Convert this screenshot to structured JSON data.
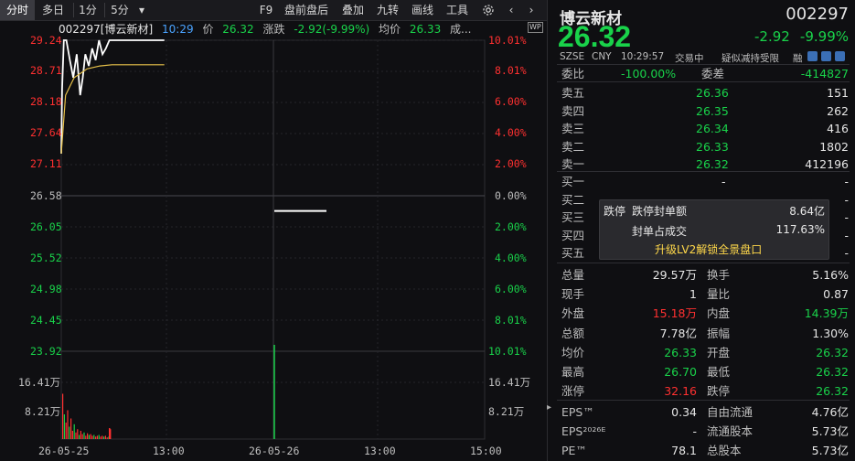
{
  "toolbar": {
    "tabs": [
      "分时",
      "多日",
      "1分",
      "5分"
    ],
    "active_tab": "分时",
    "dropdown_icon": "caret-down-icon",
    "right_items": [
      "F9",
      "盘前盘后",
      "叠加",
      "九转",
      "画线",
      "工具"
    ],
    "icons": [
      "settings-icon",
      "chevron-left-icon",
      "chevron-right-icon"
    ]
  },
  "infobar": {
    "code_name": "002297[博云新材]",
    "time": "10:29",
    "price_label": "价",
    "price": "26.32",
    "change_label": "涨跌",
    "change": "-2.92(-9.99%)",
    "avg_label": "均价",
    "avg": "26.33",
    "vol_label": "成..."
  },
  "axes": {
    "price_ticks": [
      "29.24",
      "28.71",
      "28.18",
      "27.64",
      "27.11",
      "26.58",
      "26.05",
      "25.52",
      "24.98",
      "24.45",
      "23.92"
    ],
    "pct_ticks": [
      "10.01%",
      "8.01%",
      "6.00%",
      "4.00%",
      "2.00%",
      "0.00%",
      "2.00%",
      "4.00%",
      "6.00%",
      "8.01%",
      "10.01%"
    ],
    "vol_ticks": [
      "16.41万",
      "8.21万"
    ],
    "vol_ticks_right": [
      "16.41万",
      "8.21万"
    ],
    "time_labels": [
      "26-05-25",
      "13:00",
      "26-05-26",
      "13:00",
      "15:00"
    ],
    "wp_badge": "WP"
  },
  "chart_data": {
    "type": "line",
    "title": "002297[博云新材]",
    "xlabel": "",
    "ylabel": "",
    "ylim": [
      23.92,
      29.24
    ],
    "prev_close": 26.58,
    "series": [
      {
        "name": "价",
        "x": [
          "09:30",
          "09:31",
          "09:33",
          "09:36",
          "09:40",
          "09:44",
          "09:48",
          "09:52",
          "09:55",
          "09:58",
          "10:02",
          "10:06",
          "10:10",
          "10:14",
          "10:18",
          "10:22",
          "10:26",
          "10:29",
          "11:30"
        ],
        "values": [
          27.3,
          28.4,
          29.24,
          29.24,
          28.9,
          28.6,
          29.0,
          28.3,
          28.6,
          29.0,
          28.8,
          29.1,
          28.9,
          29.24,
          29.0,
          29.1,
          29.24,
          29.24,
          29.24
        ]
      },
      {
        "name": "均价",
        "x": [
          "09:30",
          "09:35",
          "09:45",
          "10:00",
          "10:15",
          "10:29",
          "11:30"
        ],
        "values": [
          27.3,
          28.3,
          28.6,
          28.75,
          28.8,
          28.82,
          28.82
        ]
      }
    ],
    "day2": {
      "price": 26.32,
      "values": [
        26.32,
        26.32
      ]
    }
  },
  "quote": {
    "name": "博云新材",
    "code": "002297",
    "price": "26.32",
    "change": "-2.92",
    "change_pct": "-9.99%",
    "exchange": "SZSE",
    "currency": "CNY",
    "timestamp": "10:29:57",
    "status": "交易中",
    "notice": "疑似减持受限",
    "flag": "融"
  },
  "orderbook": {
    "weibi_label": "委比",
    "weibi": "-100.00%",
    "weicha_label": "委差",
    "weicha": "-414827",
    "asks": [
      {
        "label": "卖五",
        "price": "26.36",
        "vol": "151"
      },
      {
        "label": "卖四",
        "price": "26.35",
        "vol": "262"
      },
      {
        "label": "卖三",
        "price": "26.34",
        "vol": "416"
      },
      {
        "label": "卖二",
        "price": "26.33",
        "vol": "1802"
      },
      {
        "label": "卖一",
        "price": "26.32",
        "vol": "412196"
      }
    ],
    "bids": [
      {
        "label": "买一",
        "price": "-",
        "vol": "-"
      },
      {
        "label": "买二",
        "price": "-",
        "vol": "-"
      },
      {
        "label": "买三",
        "price": "-",
        "vol": "-"
      },
      {
        "label": "买四",
        "price": "-",
        "vol": "-"
      },
      {
        "label": "买五",
        "price": "-",
        "vol": "-"
      }
    ]
  },
  "popup": {
    "tag": "跌停",
    "seal_label": "跌停封单额",
    "seal_value": "8.64亿",
    "ratio_label": "封单占成交",
    "ratio_value": "117.63%",
    "upgrade": "升级LV2解锁全景盘口"
  },
  "stats": [
    {
      "l1": "总量",
      "v1": "29.57万",
      "l2": "换手",
      "v2": "5.16%",
      "c1": "white",
      "c2": "white"
    },
    {
      "l1": "现手",
      "v1": "1",
      "l2": "量比",
      "v2": "0.87",
      "c1": "white",
      "c2": "white"
    },
    {
      "l1": "外盘",
      "v1": "15.18万",
      "l2": "内盘",
      "v2": "14.39万",
      "c1": "red",
      "c2": "green"
    },
    {
      "l1": "总额",
      "v1": "7.78亿",
      "l2": "振幅",
      "v2": "1.30%",
      "c1": "white",
      "c2": "white"
    },
    {
      "l1": "均价",
      "v1": "26.33",
      "l2": "开盘",
      "v2": "26.32",
      "c1": "green",
      "c2": "green"
    },
    {
      "l1": "最高",
      "v1": "26.70",
      "l2": "最低",
      "v2": "26.32",
      "c1": "green",
      "c2": "green"
    },
    {
      "l1": "涨停",
      "v1": "32.16",
      "l2": "跌停",
      "v2": "26.32",
      "c1": "red",
      "c2": "green"
    }
  ],
  "fundamentals": [
    {
      "l1": "EPS™",
      "v1": "0.34",
      "l2": "自由流通",
      "v2": "4.76亿"
    },
    {
      "l1": "EPS²⁰²⁶ᴱ",
      "v1": "-",
      "l2": "流通股本",
      "v2": "5.73亿"
    },
    {
      "l1": "PE™",
      "v1": "78.1",
      "l2": "总股本",
      "v2": "5.73亿"
    }
  ],
  "colors": {
    "up": "#ff3030",
    "down": "#19d24a",
    "price_line": "#ffffff",
    "avg_line": "#e8c24a"
  }
}
